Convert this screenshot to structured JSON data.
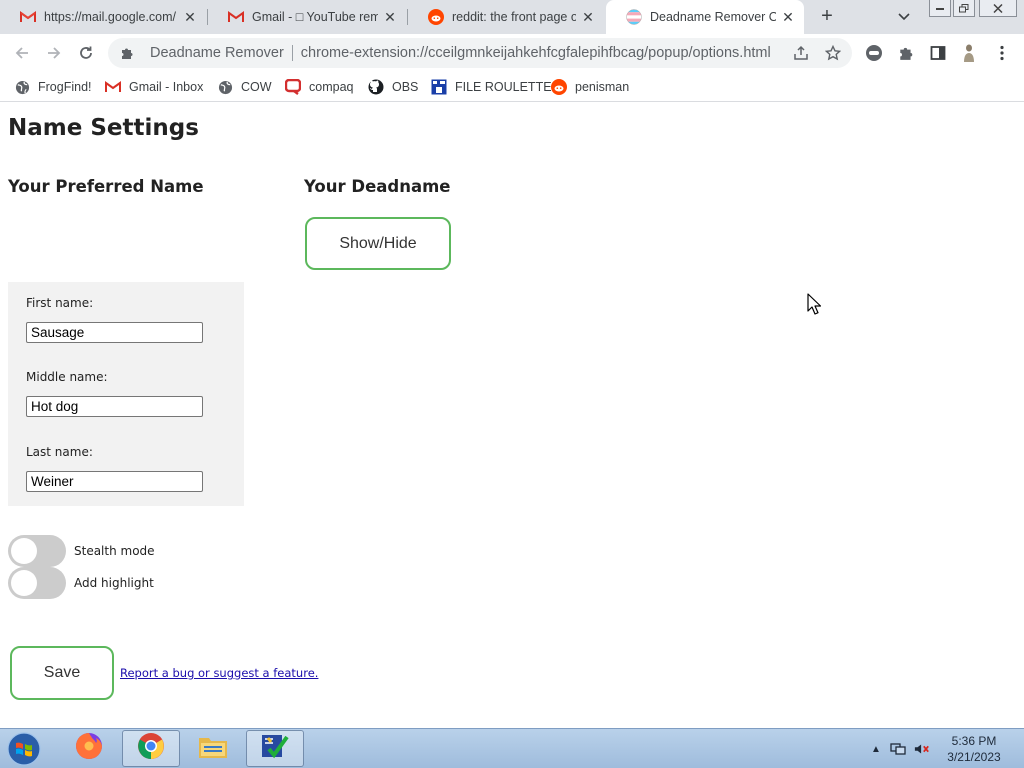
{
  "browser": {
    "tabs": [
      {
        "title": "https://mail.google.com/",
        "icon": "gmail-icon"
      },
      {
        "title": "Gmail - □ YouTube remov",
        "icon": "gmail-icon"
      },
      {
        "title": "reddit: the front page of t",
        "icon": "reddit-icon"
      },
      {
        "title": "Deadname Remover Opti",
        "icon": "trans-flag-icon",
        "active": true
      }
    ],
    "new_tab_label": "+",
    "omnibox": {
      "site_name": "Deadname Remover",
      "url": "chrome-extension://cceilgmnkeijahkehfcgfalepihfbcag/popup/options.html"
    },
    "bookmarks": [
      {
        "label": "FrogFind!",
        "icon": "globe-icon"
      },
      {
        "label": "Gmail - Inbox",
        "icon": "gmail-icon"
      },
      {
        "label": "COW",
        "icon": "globe-icon"
      },
      {
        "label": "compaq",
        "icon": "compaq-icon"
      },
      {
        "label": "OBS",
        "icon": "github-icon"
      },
      {
        "label": "FILE ROULETTE",
        "icon": "file-roulette-icon"
      },
      {
        "label": "penisman",
        "icon": "reddit-icon"
      }
    ]
  },
  "page": {
    "title": "Name Settings",
    "preferred_heading": "Your Preferred Name",
    "deadname_heading": "Your Deadname",
    "show_hide_label": "Show/Hide",
    "fields": {
      "first": {
        "label": "First name:",
        "value": "Sausage"
      },
      "middle": {
        "label": "Middle name:",
        "value": "Hot dog"
      },
      "last": {
        "label": "Last name:",
        "value": "Weiner"
      }
    },
    "toggles": {
      "stealth": {
        "label": "Stealth mode",
        "on": false
      },
      "highlight": {
        "label": "Add highlight",
        "on": false
      }
    },
    "save_label": "Save",
    "report_link": "Report a bug or suggest a feature."
  },
  "taskbar": {
    "apps": [
      "firefox-icon",
      "chrome-icon",
      "file-explorer-icon",
      "checklist-app-icon"
    ],
    "clock_time": "5:36 PM",
    "clock_date": "3/21/2023"
  },
  "colors": {
    "button_border": "#5cb85c",
    "toggle_off": "#cccccc",
    "panel_bg": "#f2f2f2",
    "link": "#1a0dab"
  }
}
